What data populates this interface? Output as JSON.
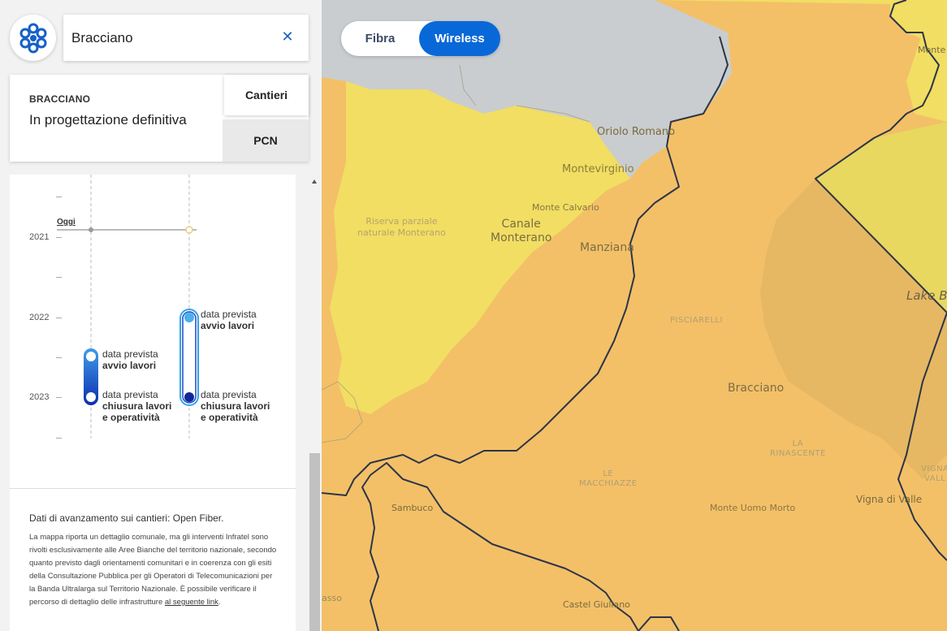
{
  "search": {
    "value": "Bracciano",
    "clear_icon": "close-icon"
  },
  "info_card": {
    "municipality": "BRACCIANO",
    "status": "In progettazione definitiva",
    "tabs": [
      "Cantieri",
      "PCN"
    ]
  },
  "map_toggle": {
    "options": [
      "Fibra",
      "Wireless"
    ],
    "selected": "Wireless"
  },
  "timeline": {
    "today_label": "Oggi",
    "years": [
      "2021",
      "2022",
      "2023"
    ],
    "fibra": {
      "start_label": "data prevista",
      "start_bold": "avvio lavori",
      "end_label": "data prevista",
      "end_bold_1": "chiusura lavori",
      "end_bold_2": "e operatività"
    },
    "wireless": {
      "start_label": "data prevista",
      "start_bold": "avvio lavori",
      "end_label": "data prevista",
      "end_bold_1": "chiusura lavori",
      "end_bold_2": "e operatività"
    }
  },
  "note": {
    "title": "Dati di avanzamento sui cantieri: Open Fiber.",
    "body": "La mappa riporta un dettaglio comunale, ma gli interventi Infratel sono rivolti esclusivamente alle Aree Bianche del territorio nazionale, secondo quanto previsto dagli orientamenti comunitari e in coerenza con gli esiti della Consultazione Pubblica per gli Operatori di Telecomunicazioni per la Banda Ultralarga sul Territorio Nazionale. È possibile verificare il percorso di dettaglio delle infrastrutture ",
    "link": "al seguente link",
    "end": "."
  },
  "map_labels": {
    "oriolo": "Oriolo Romano",
    "montevirginio": "Montevirginio",
    "monte_calvario": "Monte Calvario",
    "riserva_1": "Riserva parziale",
    "riserva_2": "naturale Monterano",
    "canale_1": "Canale",
    "canale_2": "Monterano",
    "manziana": "Manziana",
    "pisciarelli": "PISCIARELLI",
    "bracciano": "Bracciano",
    "la_1": "LA",
    "la_2": "RINASCENTE",
    "le_1": "LE",
    "le_2": "MACCHIAZZE",
    "sambuco": "Sambuco",
    "monte_uomo": "Monte Uomo Morto",
    "vigna": "Vigna di Valle",
    "castel": "Castel Giuliano",
    "lake": "Lake Br",
    "monte_top": "Monte",
    "vigna_edge_1": "VIGNA",
    "vigna_edge_2": "VALL",
    "asso": "asso"
  },
  "colors": {
    "accent": "#0968d8",
    "map_orange": "#f3c068",
    "map_yellow": "#f1de63",
    "map_grey": "#c9cdd0",
    "map_dark": "#e7b861"
  }
}
